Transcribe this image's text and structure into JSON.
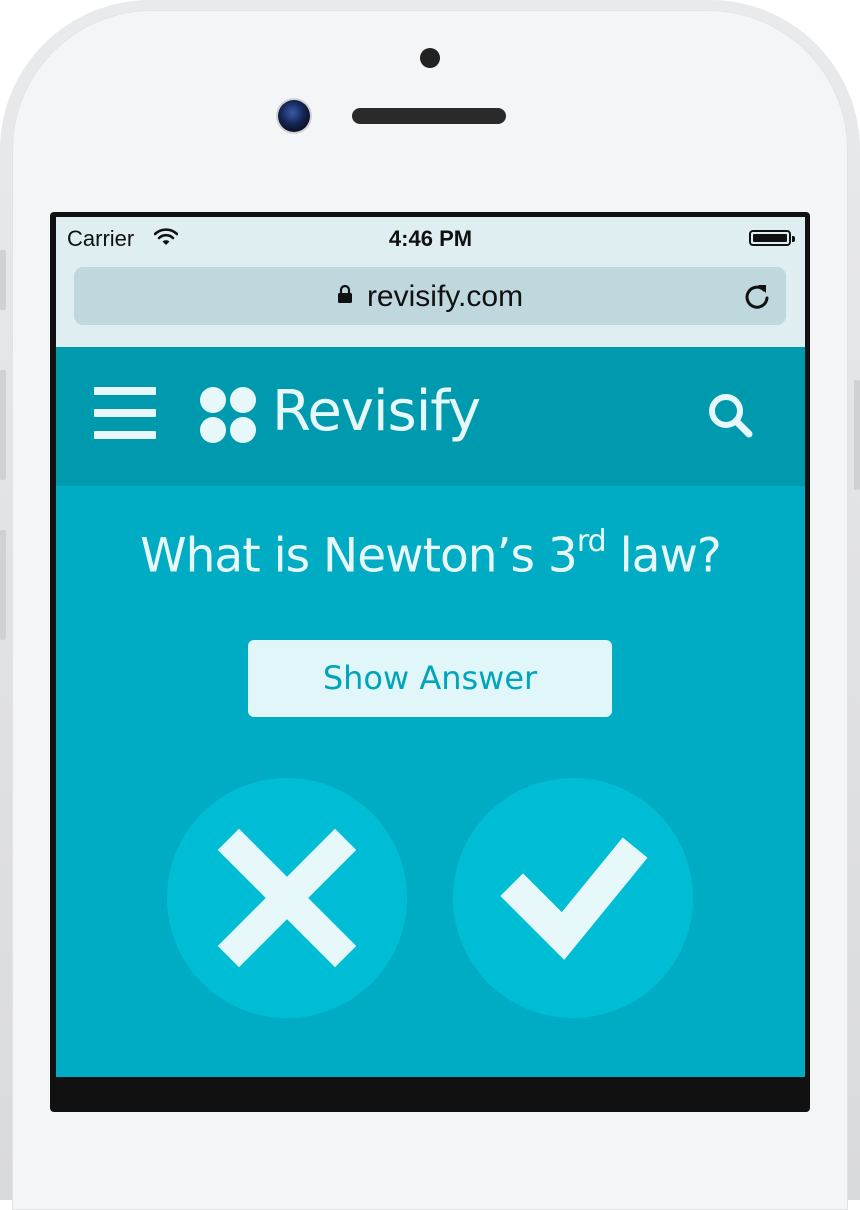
{
  "status_bar": {
    "carrier": "Carrier",
    "time": "4:46 PM",
    "wifi_icon": "wifi-icon",
    "battery_icon": "battery-icon"
  },
  "browser": {
    "url": "revisify.com",
    "lock_icon": "lock-icon",
    "reload_icon": "reload-icon"
  },
  "header": {
    "brand": "Revisify",
    "menu_icon": "hamburger-menu-icon",
    "search_icon": "search-icon"
  },
  "card": {
    "question_prefix": "What is Newton’s 3",
    "question_superscript": "rd",
    "question_suffix": " law?",
    "show_answer_label": "Show Answer"
  },
  "actions": {
    "wrong_icon": "cross-icon",
    "right_icon": "checkmark-icon"
  },
  "colors": {
    "page_background": "#00abc4",
    "header_background": "#009aaf",
    "circle_button": "#00bdd6",
    "foreground": "#e7f8fa"
  }
}
